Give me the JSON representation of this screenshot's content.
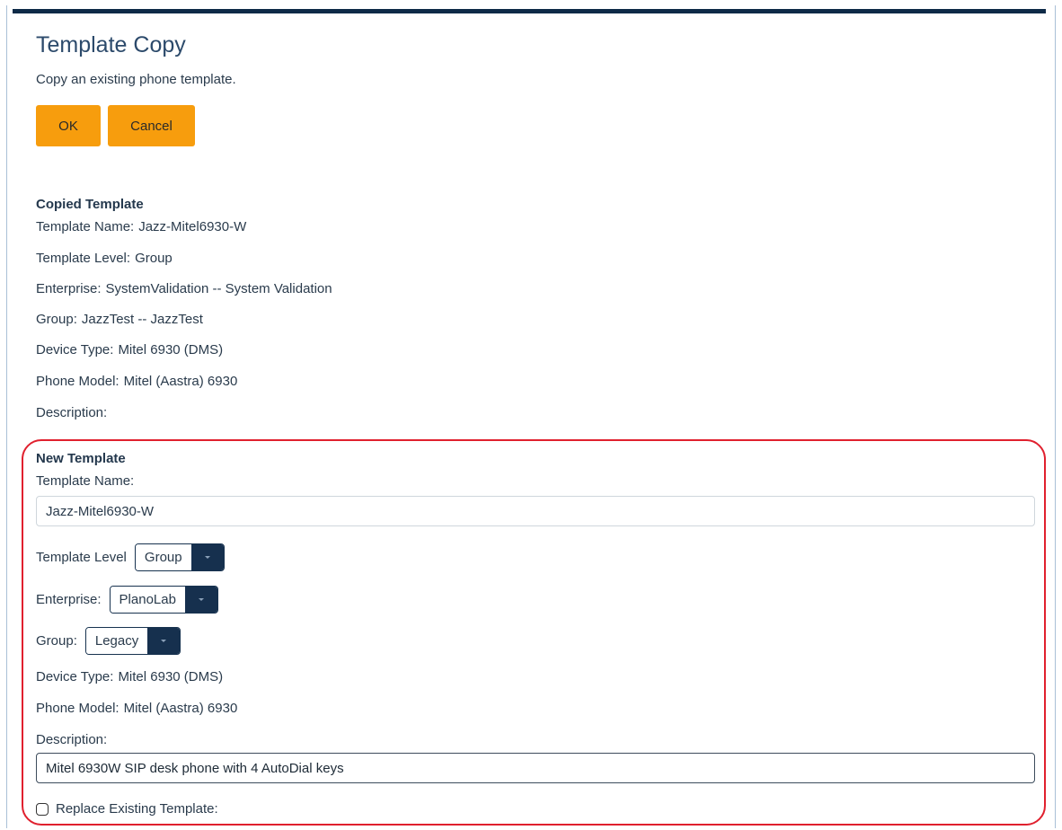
{
  "header": {
    "title": "Template Copy",
    "subtitle": "Copy an existing phone template."
  },
  "actions": {
    "ok_label": "OK",
    "cancel_label": "Cancel"
  },
  "copied": {
    "heading": "Copied Template",
    "fields": [
      {
        "label": "Template Name:",
        "value": "Jazz-Mitel6930-W"
      },
      {
        "label": "Template Level:",
        "value": "Group"
      },
      {
        "label": "Enterprise:",
        "value": "SystemValidation -- System Validation"
      },
      {
        "label": "Group:",
        "value": "JazzTest -- JazzTest"
      },
      {
        "label": "Device Type:",
        "value": "Mitel 6930 (DMS)"
      },
      {
        "label": "Phone Model:",
        "value": "Mitel (Aastra) 6930"
      },
      {
        "label": "Description:",
        "value": ""
      }
    ]
  },
  "new_template": {
    "heading": "New Template",
    "name_label": "Template Name:",
    "name_value": "Jazz-Mitel6930-W",
    "level_label": "Template Level",
    "level_value": "Group",
    "enterprise_label": "Enterprise:",
    "enterprise_value": "PlanoLab",
    "group_label": "Group:",
    "group_value": "Legacy",
    "device_type_label": "Device Type:",
    "device_type_value": "Mitel 6930 (DMS)",
    "phone_model_label": "Phone Model:",
    "phone_model_value": "Mitel (Aastra) 6930",
    "description_label": "Description:",
    "description_value": "Mitel 6930W SIP desk phone with 4 AutoDial keys",
    "replace_label": "Replace Existing Template:",
    "replace_checked": false
  },
  "colors": {
    "accent_button": "#f79d0d",
    "header_bar": "#0e2a47",
    "select_button": "#16304e",
    "highlight_border": "#e0202e",
    "title_text": "#2c4a6b"
  }
}
